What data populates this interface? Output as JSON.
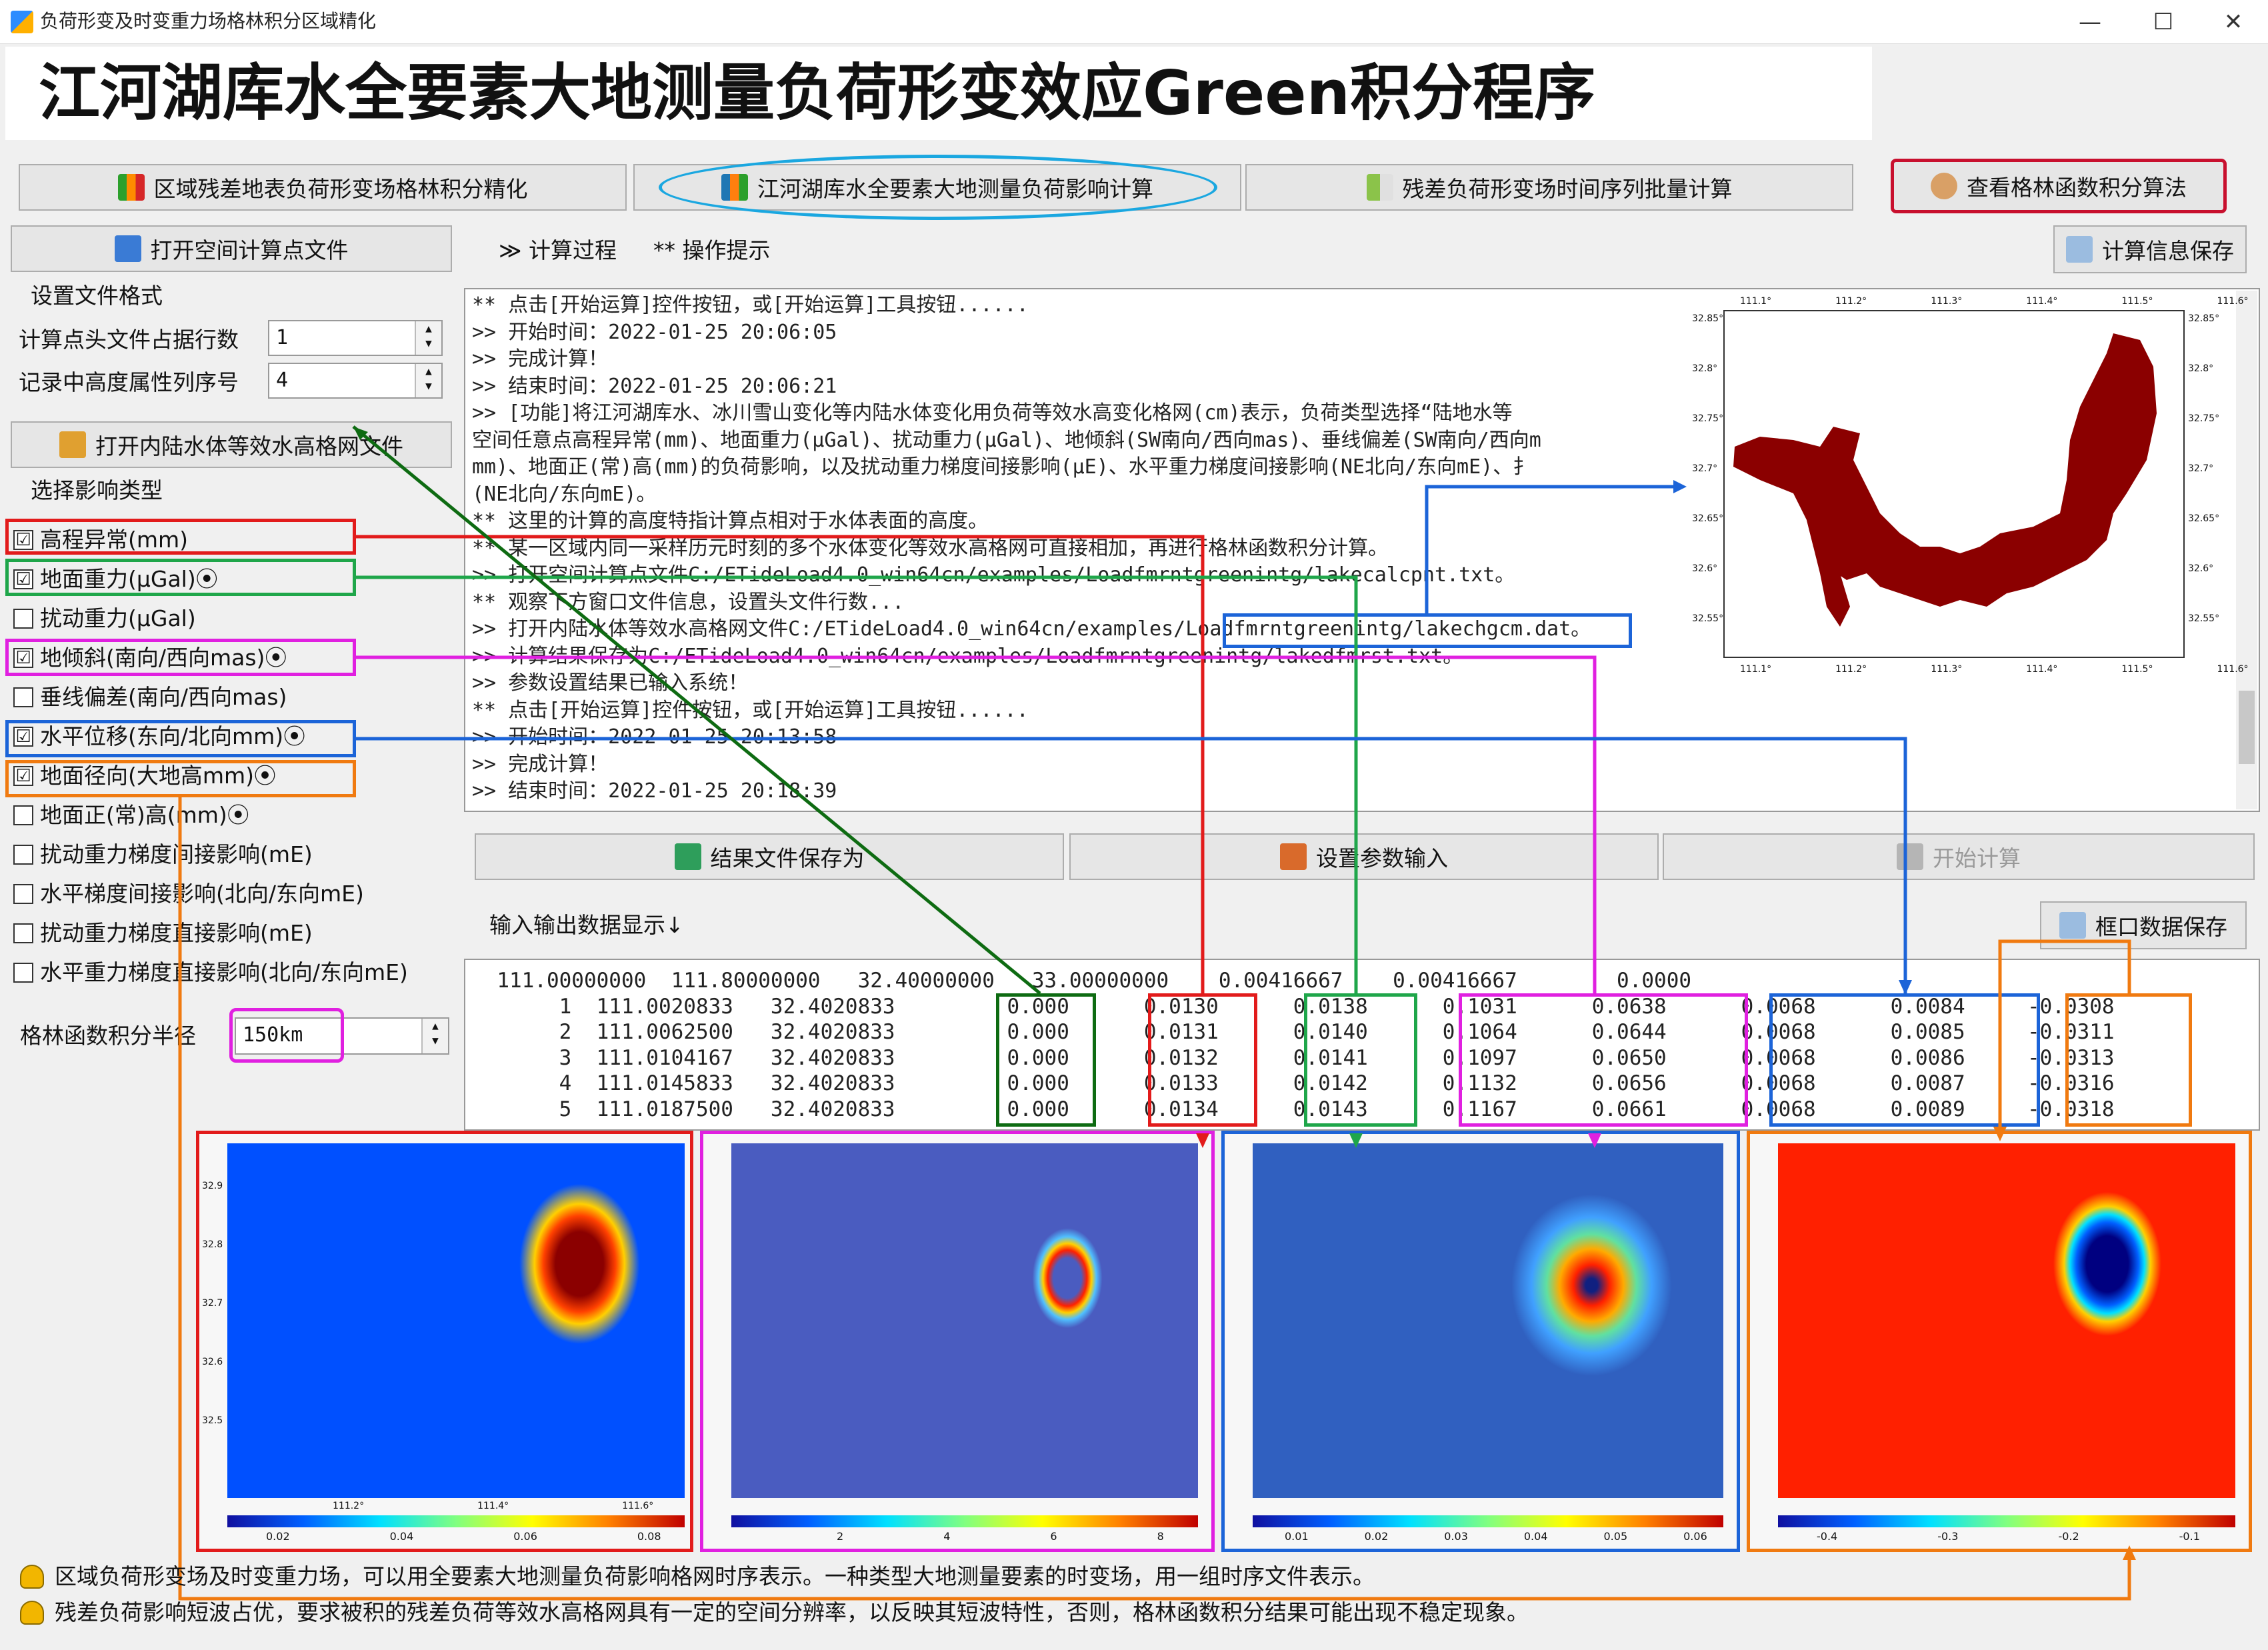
{
  "window": {
    "title": "负荷形变及时变重力场格林积分区域精化",
    "min": "—",
    "max": "☐",
    "close": "✕"
  },
  "banner": {
    "title": "江河湖库水全要素大地测量负荷形变效应Green积分程序"
  },
  "tabs": [
    {
      "label": "区域残差地表负荷形变场格林积分精化"
    },
    {
      "label": "江河湖库水全要素大地测量负荷影响计算"
    },
    {
      "label": "残差负荷形变场时间序列批量计算"
    },
    {
      "label": "查看格林函数积分算法"
    }
  ],
  "left": {
    "open_points": "打开空间计算点文件",
    "format_group": "设置文件格式",
    "header_rows_label": "计算点头文件占据行数",
    "header_rows_value": "1",
    "height_col_label": "记录中高度属性列序号",
    "height_col_value": "4",
    "open_grid": "打开内陆水体等效水高格网文件",
    "type_group": "选择影响类型",
    "types": [
      {
        "label": "高程异常(mm)",
        "mark": "☑"
      },
      {
        "label": "地面重力(μGal)⦿",
        "mark": "☑"
      },
      {
        "label": "扰动重力(μGal)",
        "mark": ""
      },
      {
        "label": "地倾斜(南向/西向mas)⦿",
        "mark": "☑"
      },
      {
        "label": "垂线偏差(南向/西向mas)",
        "mark": ""
      },
      {
        "label": "水平位移(东向/北向mm)⦿",
        "mark": "☑"
      },
      {
        "label": "地面径向(大地高mm)⦿",
        "mark": "☑"
      },
      {
        "label": "地面正(常)高(mm)⦿",
        "mark": ""
      },
      {
        "label": "扰动重力梯度间接影响(mE)",
        "mark": ""
      },
      {
        "label": "水平梯度间接影响(北向/东向mE)",
        "mark": ""
      },
      {
        "label": "扰动重力梯度直接影响(mE)",
        "mark": ""
      },
      {
        "label": "水平重力梯度直接影响(北向/东向mE)",
        "mark": ""
      }
    ],
    "radius_label": "格林函数积分半径",
    "radius_value": "150km"
  },
  "process": {
    "tab1": "≫ 计算过程",
    "tab2": "** 操作提示",
    "save_info": "计算信息保存",
    "lines": [
      "  ** 点击[开始运算]控件按钮，或[开始运算]工具按钮......",
      ">> 开始时间：2022-01-25 20:06:05",
      ">> 完成计算！",
      ">> 结束时间：2022-01-25 20:06:21",
      ">> [功能]将江河湖库水、冰川雪山变化等内陆水体变化用负荷等效水高变化格网(cm)表示，负荷类型选择“陆地水等",
      "空间任意点高程异常(mm)、地面重力(μGal)、扰动重力(μGal)、地倾斜(SW南向/西向mas)、垂线偏差(SW南向/西向m",
      "mm)、地面正(常)高(mm)的负荷影响，以及扰动重力梯度间接影响(μE)、水平重力梯度间接影响(NE北向/东向mE)、扌",
      "(NE北向/东向mE)。",
      "  ** 这里的计算的高度特指计算点相对于水体表面的高度。",
      "  ** 某一区域内同一采样历元时刻的多个水体变化等效水高格网可直接相加，再进行格林函数积分计算。",
      ">> 打开空间计算点文件C:/ETideLoad4.0_win64cn/examples/Loadfmrntgreenintg/lakecalcpnt.txt。",
      "  ** 观察下方窗口文件信息，设置头文件行数...",
      ">> 打开内陆水体等效水高格网文件C:/ETideLoad4.0_win64cn/examples/Loadfmrntgreenintg/lakechgcm.dat。",
      ">> 计算结果保存为C:/ETideLoad4.0_win64cn/examples/Loadfmrntgreenintg/lakedfmrst.txt。",
      ">> 参数设置结果已输入系统！",
      "  ** 点击[开始运算]控件按钮，或[开始运算]工具按钮......",
      ">> 开始时间：2022-01-25 20:13:58",
      ">> 完成计算！",
      ">> 结束时间：2022-01-25 20:18:39"
    ]
  },
  "actions": {
    "save_result": "结果文件保存为",
    "set_params": "设置参数输入",
    "start": "开始计算"
  },
  "io": {
    "label": "输入输出数据显示↓",
    "save_window": "框口数据保存",
    "rows": [
      "  111.00000000  111.80000000   32.40000000   33.00000000    0.00416667    0.00416667        0.0000",
      "       1  111.0020833   32.4020833         0.000      0.0130      0.0138      0.1031      0.0638      0.0068      0.0084     -0.0308",
      "       2  111.0062500   32.4020833         0.000      0.0131      0.0140      0.1064      0.0644      0.0068      0.0085     -0.0311",
      "       3  111.0104167   32.4020833         0.000      0.0132      0.0141      0.1097      0.0650      0.0068      0.0086     -0.0313",
      "       4  111.0145833   32.4020833         0.000      0.0133      0.0142      0.1132      0.0656      0.0068      0.0087     -0.0316",
      "       5  111.0187500   32.4020833         0.000      0.0134      0.0143      0.1167      0.0661      0.0068      0.0089     -0.0318"
    ]
  },
  "map_top": {
    "x_ticks": [
      "111.1°",
      "111.2°",
      "111.3°",
      "111.4°",
      "111.5°",
      "111.6°"
    ],
    "y_ticks": [
      "32.85°",
      "32.8°",
      "32.75°",
      "32.7°",
      "32.65°",
      "32.6°",
      "32.55°"
    ]
  },
  "maps": [
    {
      "ticks": [
        "0.02",
        "0.04",
        "0.06",
        "0.08"
      ]
    },
    {
      "ticks": [
        "2",
        "4",
        "6",
        "8"
      ]
    },
    {
      "ticks": [
        "0.01",
        "0.02",
        "0.03",
        "0.04",
        "0.05",
        "0.06"
      ]
    },
    {
      "ticks": [
        "-0.4",
        "-0.3",
        "-0.2",
        "-0.1"
      ]
    }
  ],
  "map_axis": {
    "y": [
      "32.9",
      "32.8",
      "32.7",
      "32.6",
      "32.5"
    ],
    "x": [
      "111.2°",
      "111.4°",
      "111.6°"
    ]
  },
  "status": [
    "区域负荷形变场及时变重力场，可以用全要素大地测量负荷影响格网时序表示。一种类型大地测量要素的时变场，用一组时序文件表示。",
    "残差负荷影响短波占优，要求被积的残差负荷等效水高格网具有一定的空间分辨率，以反映其短波特性，否则，格林函数积分结果可能出现不稳定现象。"
  ],
  "colors": {
    "red": "#e21b1b",
    "green": "#1fa64a",
    "magenta": "#e020e0",
    "blue": "#1c64d8",
    "orange": "#f07a10",
    "darkgreen": "#0e6b12",
    "cyan": "#1aa7e0",
    "lake": "#8b0000"
  }
}
